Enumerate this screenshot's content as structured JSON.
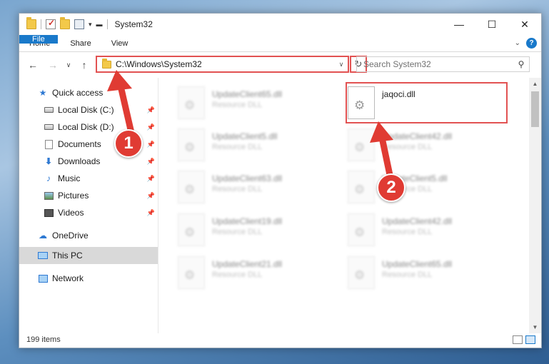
{
  "window": {
    "title": "System32",
    "controls": {
      "minimize": "—",
      "maximize": "☐",
      "close": "✕"
    }
  },
  "ribbon": {
    "tabs": [
      "File",
      "Home",
      "Share",
      "View"
    ]
  },
  "nav": {
    "back": "←",
    "forward": "→",
    "recent": "∨",
    "up": "↑",
    "address": "C:\\Windows\\System32",
    "refresh": "↻",
    "search_placeholder": "Search System32"
  },
  "sidebar": {
    "quick_access": "Quick access",
    "pinned": [
      {
        "label": "Local Disk (C:)",
        "icon": "drive-icon"
      },
      {
        "label": "Local Disk (D:)",
        "icon": "drive-icon"
      },
      {
        "label": "Documents",
        "icon": "documents-icon"
      },
      {
        "label": "Downloads",
        "icon": "downloads-icon"
      },
      {
        "label": "Music",
        "icon": "music-icon"
      },
      {
        "label": "Pictures",
        "icon": "pictures-icon"
      },
      {
        "label": "Videos",
        "icon": "videos-icon"
      }
    ],
    "onedrive": "OneDrive",
    "this_pc": "This PC",
    "network": "Network"
  },
  "files": [
    {
      "name": "UpdateClient65.dll",
      "type": "Resource DLL"
    },
    {
      "name": "jaqoci.dll",
      "type": ""
    },
    {
      "name": "UpdateClient5.dll",
      "type": "Resource DLL"
    },
    {
      "name": "UpdateClient42.dll",
      "type": "Resource DLL"
    },
    {
      "name": "UpdateClient63.dll",
      "type": "Resource DLL"
    },
    {
      "name": "UpdateClient5.dll",
      "type": "Resource DLL"
    },
    {
      "name": "UpdateClient19.dll",
      "type": "Resource DLL"
    },
    {
      "name": "UpdateClient42.dll",
      "type": "Resource DLL"
    },
    {
      "name": "UpdateClient21.dll",
      "type": "Resource DLL"
    },
    {
      "name": "UpdateClient65.dll",
      "type": "Resource DLL"
    }
  ],
  "status": {
    "item_count": "199 items"
  },
  "annotations": {
    "step1": "1",
    "step2": "2",
    "color": "#e03b33"
  }
}
